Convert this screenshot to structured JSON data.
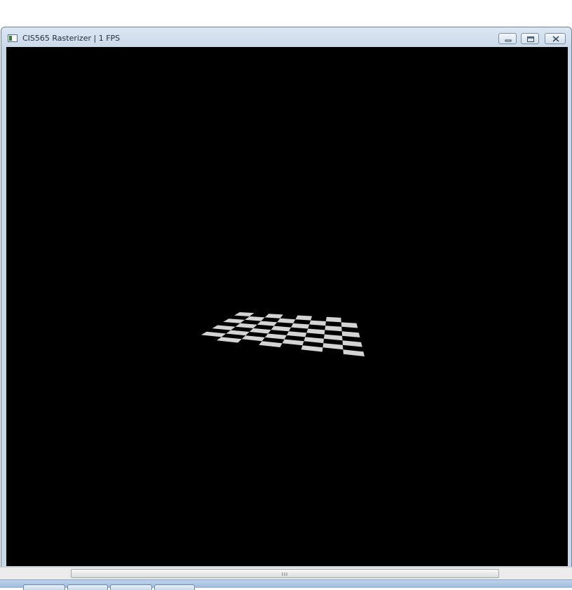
{
  "window": {
    "title": "CIS565 Rasterizer | 1 FPS",
    "icons": {
      "app": "app-window-icon",
      "minimize": "minimize-icon",
      "maximize": "maximize-icon",
      "close": "close-icon"
    }
  },
  "viewport": {
    "background": "#000000",
    "scene": "checkerboard plane",
    "tile_color": "#d4d4d4"
  },
  "scrollbar": {
    "grip": "III"
  }
}
